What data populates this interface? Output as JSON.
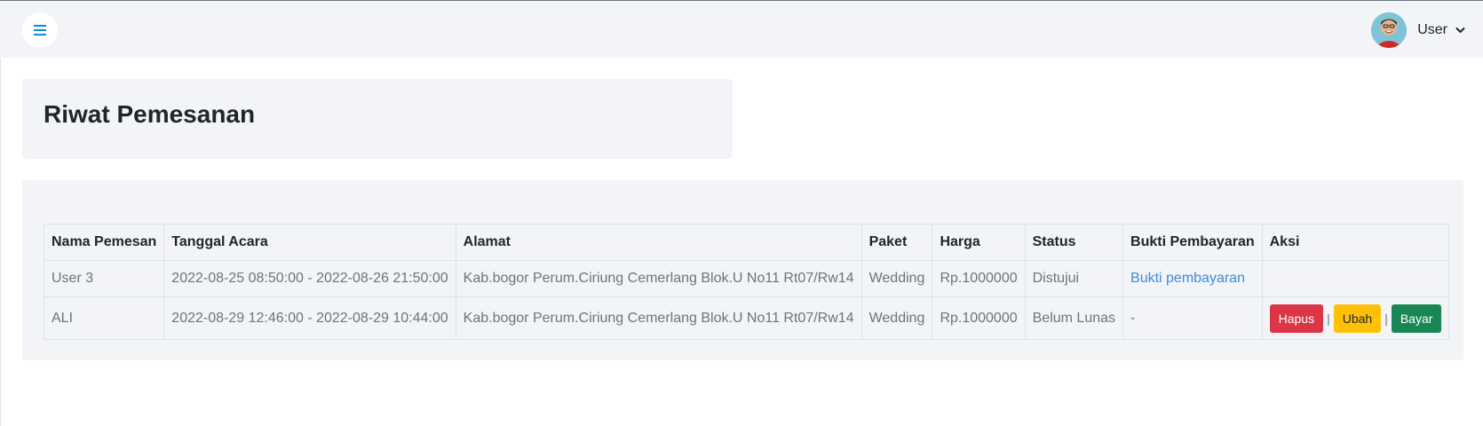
{
  "header": {
    "menu_icon": "hamburger-icon",
    "user_name": "User",
    "dropdown_icon": "chevron-down-icon",
    "accent_color": "#0d8bd9"
  },
  "page": {
    "title": "Riwat Pemesanan"
  },
  "table": {
    "headers": [
      "Nama Pemesan",
      "Tanggal Acara",
      "Alamat",
      "Paket",
      "Harga",
      "Status",
      "Bukti Pembayaran",
      "Aksi"
    ],
    "rows": [
      {
        "nama": "User 3",
        "tanggal": "2022-08-25 08:50:00 - 2022-08-26 21:50:00",
        "alamat": "Kab.bogor Perum.Ciriung Cemerlang Blok.U No11 Rt07/Rw14",
        "paket": "Wedding",
        "harga": "Rp.1000000",
        "status": "Distujui",
        "bukti": "Bukti pembayaran"
      },
      {
        "nama": "ALI",
        "tanggal": "2022-08-29 12:46:00 - 2022-08-29 10:44:00",
        "alamat": "Kab.bogor Perum.Ciriung Cemerlang Blok.U No11 Rt07/Rw14",
        "paket": "Wedding",
        "harga": "Rp.1000000",
        "status": "Belum Lunas",
        "bukti": "-",
        "actions": {
          "hapus": "Hapus",
          "ubah": "Ubah",
          "bayar": "Bayar",
          "separator": "|"
        }
      }
    ]
  },
  "colors": {
    "danger": "#dc3545",
    "warning": "#ffc107",
    "success": "#198754",
    "link": "#3c8dd8"
  }
}
